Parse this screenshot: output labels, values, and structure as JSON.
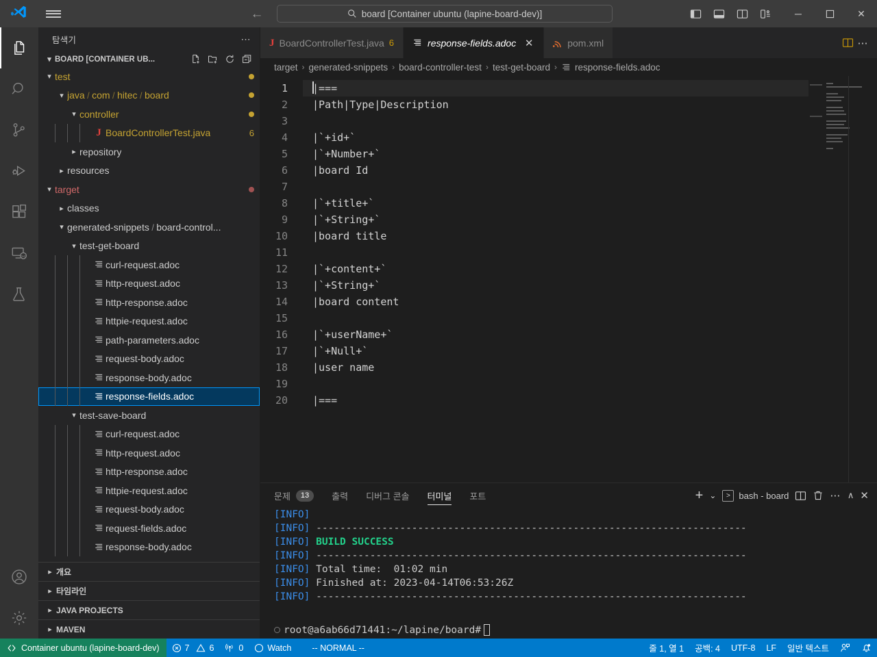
{
  "titlebar": {
    "search_text": "board [Container ubuntu (lapine-board-dev)]",
    "back_arrow": "←",
    "forward_arrow": "→",
    "minimize": "─",
    "maximize": "☐",
    "close": "✕"
  },
  "activitybar": {
    "items": [
      {
        "name": "explorer",
        "icon": "files-icon"
      },
      {
        "name": "search",
        "icon": "search-icon"
      },
      {
        "name": "source-control",
        "icon": "source-control-icon"
      },
      {
        "name": "run-debug",
        "icon": "run-debug-icon"
      },
      {
        "name": "extensions",
        "icon": "extensions-icon"
      },
      {
        "name": "remote-explorer",
        "icon": "remote-explorer-icon"
      },
      {
        "name": "testing",
        "icon": "testing-icon"
      }
    ],
    "accounts_icon": "account-icon",
    "settings_icon": "gear-icon"
  },
  "sidebar": {
    "title": "탐색기",
    "more_actions": "⋯",
    "root_label": "BOARD [CONTAINER UB...",
    "tree": [
      {
        "label": "test",
        "indent": 1,
        "twisty": "down",
        "type": "folder",
        "color": "#c5a332",
        "dot": "#c5a332"
      },
      {
        "label": "java / com / hitec / board",
        "indent": 2,
        "twisty": "down",
        "type": "folder",
        "color": "#c5a332",
        "dot": "#c5a332"
      },
      {
        "label": "controller",
        "indent": 3,
        "twisty": "down",
        "type": "folder",
        "color": "#c5a332",
        "dot": "#c5a332"
      },
      {
        "label": "BoardControllerTest.java",
        "indent": 4,
        "twisty": "none",
        "type": "java",
        "color": "#c5a332",
        "badge": "6"
      },
      {
        "label": "repository",
        "indent": 3,
        "twisty": "right",
        "type": "folder",
        "color": "#cccccc"
      },
      {
        "label": "resources",
        "indent": 2,
        "twisty": "right",
        "type": "folder",
        "color": "#cccccc"
      },
      {
        "label": "target",
        "indent": 1,
        "twisty": "down",
        "type": "folder",
        "color": "#d16969",
        "dot": "#a05252"
      },
      {
        "label": "classes",
        "indent": 2,
        "twisty": "right",
        "type": "folder",
        "color": "#cccccc"
      },
      {
        "label": "generated-snippets / board-control...",
        "indent": 2,
        "twisty": "down",
        "type": "folder",
        "color": "#cccccc"
      },
      {
        "label": "test-get-board",
        "indent": 3,
        "twisty": "down",
        "type": "folder",
        "color": "#cccccc"
      },
      {
        "label": "curl-request.adoc",
        "indent": 4,
        "twisty": "none",
        "type": "adoc",
        "color": "#cccccc"
      },
      {
        "label": "http-request.adoc",
        "indent": 4,
        "twisty": "none",
        "type": "adoc",
        "color": "#cccccc"
      },
      {
        "label": "http-response.adoc",
        "indent": 4,
        "twisty": "none",
        "type": "adoc",
        "color": "#cccccc"
      },
      {
        "label": "httpie-request.adoc",
        "indent": 4,
        "twisty": "none",
        "type": "adoc",
        "color": "#cccccc"
      },
      {
        "label": "path-parameters.adoc",
        "indent": 4,
        "twisty": "none",
        "type": "adoc",
        "color": "#cccccc"
      },
      {
        "label": "request-body.adoc",
        "indent": 4,
        "twisty": "none",
        "type": "adoc",
        "color": "#cccccc"
      },
      {
        "label": "response-body.adoc",
        "indent": 4,
        "twisty": "none",
        "type": "adoc",
        "color": "#cccccc"
      },
      {
        "label": "response-fields.adoc",
        "indent": 4,
        "twisty": "none",
        "type": "adoc",
        "color": "#ffffff",
        "selected": true
      },
      {
        "label": "test-save-board",
        "indent": 3,
        "twisty": "down",
        "type": "folder",
        "color": "#cccccc"
      },
      {
        "label": "curl-request.adoc",
        "indent": 4,
        "twisty": "none",
        "type": "adoc",
        "color": "#cccccc"
      },
      {
        "label": "http-request.adoc",
        "indent": 4,
        "twisty": "none",
        "type": "adoc",
        "color": "#cccccc"
      },
      {
        "label": "http-response.adoc",
        "indent": 4,
        "twisty": "none",
        "type": "adoc",
        "color": "#cccccc"
      },
      {
        "label": "httpie-request.adoc",
        "indent": 4,
        "twisty": "none",
        "type": "adoc",
        "color": "#cccccc"
      },
      {
        "label": "request-body.adoc",
        "indent": 4,
        "twisty": "none",
        "type": "adoc",
        "color": "#cccccc"
      },
      {
        "label": "request-fields.adoc",
        "indent": 4,
        "twisty": "none",
        "type": "adoc",
        "color": "#cccccc"
      },
      {
        "label": "response-body.adoc",
        "indent": 4,
        "twisty": "none",
        "type": "adoc",
        "color": "#cccccc"
      }
    ],
    "collapsed_sections": [
      {
        "label": "개요"
      },
      {
        "label": "타임라인"
      },
      {
        "label": "JAVA PROJECTS"
      },
      {
        "label": "MAVEN"
      }
    ]
  },
  "editor": {
    "tabs": [
      {
        "label": "BoardControllerTest.java",
        "icon": "java-icon",
        "badge": "6",
        "active": false,
        "closable": false,
        "italic": false
      },
      {
        "label": "response-fields.adoc",
        "icon": "adoc-icon",
        "badge": "",
        "active": true,
        "closable": true,
        "italic": true
      },
      {
        "label": "pom.xml",
        "icon": "xml-icon",
        "badge": "",
        "active": false,
        "closable": false,
        "italic": false
      }
    ],
    "tab_close": "✕",
    "actions": {
      "split_editor": "split-editor-icon",
      "more": "⋯"
    },
    "breadcrumb": [
      "target",
      "generated-snippets",
      "board-controller-test",
      "test-get-board",
      "response-fields.adoc"
    ],
    "breadcrumb_separator": "›",
    "lines": [
      {
        "n": "1",
        "text": "|===",
        "current": true
      },
      {
        "n": "2",
        "text": "|Path|Type|Description"
      },
      {
        "n": "3",
        "text": ""
      },
      {
        "n": "4",
        "text": "|`+id+`"
      },
      {
        "n": "5",
        "text": "|`+Number+`"
      },
      {
        "n": "6",
        "text": "|board Id"
      },
      {
        "n": "7",
        "text": ""
      },
      {
        "n": "8",
        "text": "|`+title+`"
      },
      {
        "n": "9",
        "text": "|`+String+`"
      },
      {
        "n": "10",
        "text": "|board title"
      },
      {
        "n": "11",
        "text": ""
      },
      {
        "n": "12",
        "text": "|`+content+`"
      },
      {
        "n": "13",
        "text": "|`+String+`"
      },
      {
        "n": "14",
        "text": "|board content"
      },
      {
        "n": "15",
        "text": ""
      },
      {
        "n": "16",
        "text": "|`+userName+`"
      },
      {
        "n": "17",
        "text": "|`+Null+`"
      },
      {
        "n": "18",
        "text": "|user name"
      },
      {
        "n": "19",
        "text": ""
      },
      {
        "n": "20",
        "text": "|==="
      }
    ]
  },
  "panel": {
    "tabs": [
      {
        "label": "문제",
        "count": "13",
        "active": false
      },
      {
        "label": "출력",
        "count": "",
        "active": false
      },
      {
        "label": "디버그 콘솔",
        "count": "",
        "active": false
      },
      {
        "label": "터미널",
        "count": "",
        "active": true
      },
      {
        "label": "포트",
        "count": "",
        "active": false
      }
    ],
    "actions": {
      "new_terminal": "+",
      "new_terminal_dropdown": "⌄",
      "terminal_name": "bash - board",
      "split": "split-terminal-icon",
      "kill": "trash-icon",
      "more": "⋯",
      "maximize": "∧",
      "close": "✕"
    },
    "terminal_lines": [
      {
        "prefix": "[INFO]",
        "text": ""
      },
      {
        "prefix": "[INFO]",
        "text": " ------------------------------------------------------------------------"
      },
      {
        "prefix": "[INFO]",
        "text": " BUILD SUCCESS",
        "style": "green"
      },
      {
        "prefix": "[INFO]",
        "text": " ------------------------------------------------------------------------"
      },
      {
        "prefix": "[INFO]",
        "text": " Total time:  01:02 min"
      },
      {
        "prefix": "[INFO]",
        "text": " Finished at: 2023-04-14T06:53:26Z"
      },
      {
        "prefix": "[INFO]",
        "text": " ------------------------------------------------------------------------"
      }
    ],
    "prompt": "root@a6ab66d71441:~/lapine/board#"
  },
  "statusbar": {
    "remote_label": "Container ubuntu (lapine-board-dev)",
    "errors": "7",
    "warnings": "6",
    "ports": "0",
    "watch": "Watch",
    "vim_mode": "-- NORMAL --",
    "cursor_position": "줄 1, 열 1",
    "indentation": "공백: 4",
    "encoding": "UTF-8",
    "eol": "LF",
    "language": "일반 텍스트",
    "feedback_icon": "feedback-icon",
    "bell_icon": "bell-icon"
  },
  "colors": {
    "accent": "#007acc",
    "remote_green": "#16825d",
    "selection_blue": "#04395e",
    "selection_border": "#0097fb",
    "build_success_green": "#23d18b",
    "info_blue": "#3b8eea"
  }
}
